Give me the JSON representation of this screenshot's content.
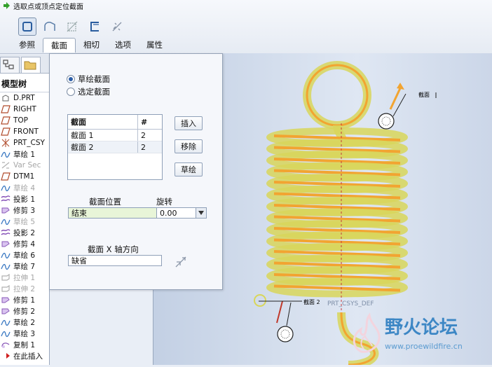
{
  "prompt": "选取点或顶点定位截面",
  "toolbar": {
    "icons": [
      "sketch-mode-icon",
      "surface-icon",
      "dim-icon",
      "section-icon",
      "no-vertex-icon"
    ]
  },
  "tabs": [
    {
      "label": "参照",
      "active": false
    },
    {
      "label": "截面",
      "active": true
    },
    {
      "label": "相切",
      "active": false
    },
    {
      "label": "选项",
      "active": false
    },
    {
      "label": "属性",
      "active": false
    }
  ],
  "tree": {
    "header": "模型树",
    "items": [
      {
        "label": "D.PRT",
        "icon": "part-icon",
        "dim": false
      },
      {
        "label": "RIGHT",
        "icon": "plane-icon",
        "dim": false
      },
      {
        "label": "TOP",
        "icon": "plane-icon",
        "dim": false
      },
      {
        "label": "FRONT",
        "icon": "plane-icon",
        "dim": false
      },
      {
        "label": "PRT_CSY",
        "icon": "csys-icon",
        "dim": false
      },
      {
        "label": "草绘 1",
        "icon": "sketch-icon",
        "dim": false
      },
      {
        "label": "Var Sec",
        "icon": "var-sec-icon",
        "dim": true
      },
      {
        "label": "DTM1",
        "icon": "plane-icon",
        "dim": false
      },
      {
        "label": "草绘 4",
        "icon": "sketch-icon",
        "dim": true
      },
      {
        "label": "投影 1",
        "icon": "project-icon",
        "dim": false
      },
      {
        "label": "修剪 3",
        "icon": "trim-icon",
        "dim": false
      },
      {
        "label": "草绘 5",
        "icon": "sketch-icon",
        "dim": true
      },
      {
        "label": "投影 2",
        "icon": "project-icon",
        "dim": false
      },
      {
        "label": "修剪 4",
        "icon": "trim-icon",
        "dim": false
      },
      {
        "label": "草绘 6",
        "icon": "sketch-icon",
        "dim": false
      },
      {
        "label": "草绘 7",
        "icon": "sketch-icon",
        "dim": false
      },
      {
        "label": "拉伸 1",
        "icon": "extrude-icon",
        "dim": true
      },
      {
        "label": "拉伸 2",
        "icon": "extrude-icon",
        "dim": true
      },
      {
        "label": "修剪 1",
        "icon": "trim-icon",
        "dim": false
      },
      {
        "label": "修剪 2",
        "icon": "trim-icon",
        "dim": false
      },
      {
        "label": "草绘 2",
        "icon": "sketch-icon",
        "dim": false
      },
      {
        "label": "草绘 3",
        "icon": "sketch-icon",
        "dim": false
      },
      {
        "label": "复制 1",
        "icon": "copy-icon",
        "dim": false
      },
      {
        "label": "在此插入",
        "icon": "insert-arrow-icon",
        "dim": false
      }
    ]
  },
  "dialog": {
    "radio_sketch": "草绘截面",
    "radio_select": "选定截面",
    "selected_radio": "草绘截面",
    "table": {
      "col_section": "截面",
      "col_num": "#",
      "rows": [
        {
          "name": "截面 1",
          "num": "2"
        },
        {
          "name": "截面 2",
          "num": "2"
        }
      ]
    },
    "insert_btn": "插入",
    "remove_btn": "移除",
    "sketch_btn": "草绘",
    "position_label": "截面位置",
    "position_value": "结束",
    "rotate_label": "旋转",
    "rotate_value": "0.00",
    "xaxis_label": "截面 X 轴方向",
    "xaxis_value": "缺省"
  },
  "viewport": {
    "label_top": "截面",
    "label_bottom": "截面 2",
    "label_bottom_tail": "PRT_CSYS_DEF",
    "spring_color": "#f2a431",
    "wire_color": "#d8d65a"
  },
  "watermark": {
    "title": "野火论坛",
    "url": "www.proewildfire.cn"
  }
}
